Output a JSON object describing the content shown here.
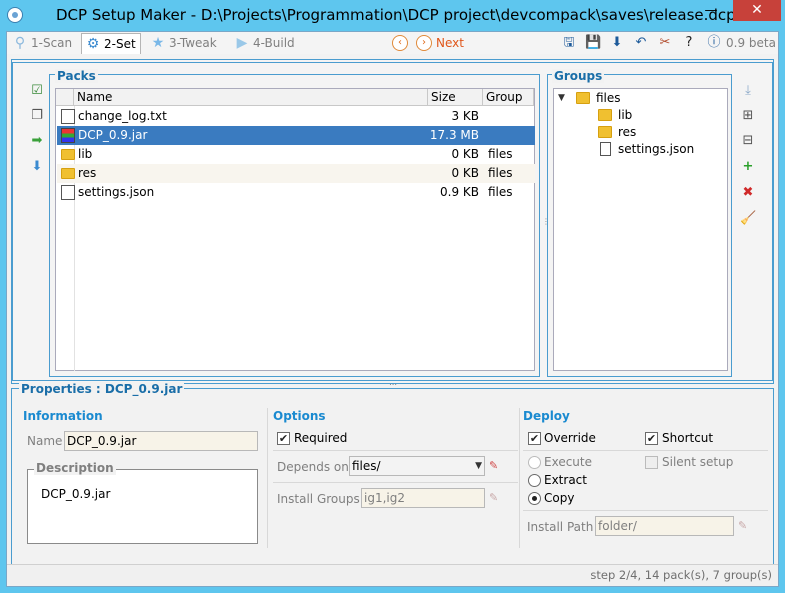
{
  "window": {
    "title": "DCP Setup Maker - D:\\Projects\\Programmation\\DCP project\\devcompack\\saves\\release.dcp",
    "minimize": "—",
    "maximize": "☐",
    "close": "✕"
  },
  "toolbar": {
    "tabs": [
      {
        "label": "1-Scan",
        "icon": "magnifier-icon"
      },
      {
        "label": "2-Set",
        "icon": "gear-icon"
      },
      {
        "label": "3-Tweak",
        "icon": "star-icon"
      },
      {
        "label": "4-Build",
        "icon": "play-icon"
      }
    ],
    "prev_glyph": "‹",
    "next_glyph": "›",
    "next_label": "Next",
    "version": "0.9 beta",
    "accent": "#e0561a"
  },
  "packs": {
    "legend": "Packs",
    "columns": [
      "Name",
      "Size",
      "Group"
    ],
    "rows": [
      {
        "name": "change_log.txt",
        "size": "3 KB",
        "group": "",
        "icon": "text-file-icon"
      },
      {
        "name": "DCP_0.9.jar",
        "size": "17.3 MB",
        "group": "",
        "icon": "archive-icon",
        "selected": true
      },
      {
        "name": "lib",
        "size": "0 KB",
        "group": "files",
        "icon": "folder-icon"
      },
      {
        "name": "res",
        "size": "0 KB",
        "group": "files",
        "icon": "folder-icon"
      },
      {
        "name": "settings.json",
        "size": "0.9 KB",
        "group": "files",
        "icon": "file-icon"
      }
    ]
  },
  "groups": {
    "legend": "Groups",
    "tree": {
      "root": "files",
      "children": [
        "lib",
        "res",
        "settings.json"
      ]
    }
  },
  "properties": {
    "legend": "Properties : DCP_0.9.jar",
    "information": {
      "title": "Information",
      "name_label": "Name",
      "name_value": "DCP_0.9.jar",
      "description_legend": "Description",
      "description_value": "DCP_0.9.jar"
    },
    "options": {
      "title": "Options",
      "required_label": "Required",
      "required_checked": true,
      "depends_label": "Depends on",
      "depends_value": "files/",
      "install_groups_label": "Install Groups",
      "install_groups_value": "ig1,ig2"
    },
    "deploy": {
      "title": "Deploy",
      "override_label": "Override",
      "override_checked": true,
      "shortcut_label": "Shortcut",
      "shortcut_checked": true,
      "execute_label": "Execute",
      "silent_label": "Silent setup",
      "extract_label": "Extract",
      "copy_label": "Copy",
      "selected_action": "Copy",
      "install_path_label": "Install Path",
      "install_path_value": "folder/"
    }
  },
  "status": {
    "text": "step 2/4, 14 pack(s), 7 group(s)"
  },
  "colors": {
    "chrome": "#5ec6ee",
    "selection": "#3a7bc0",
    "section_title": "#1a8ad0",
    "close_button": "#c7413a"
  }
}
